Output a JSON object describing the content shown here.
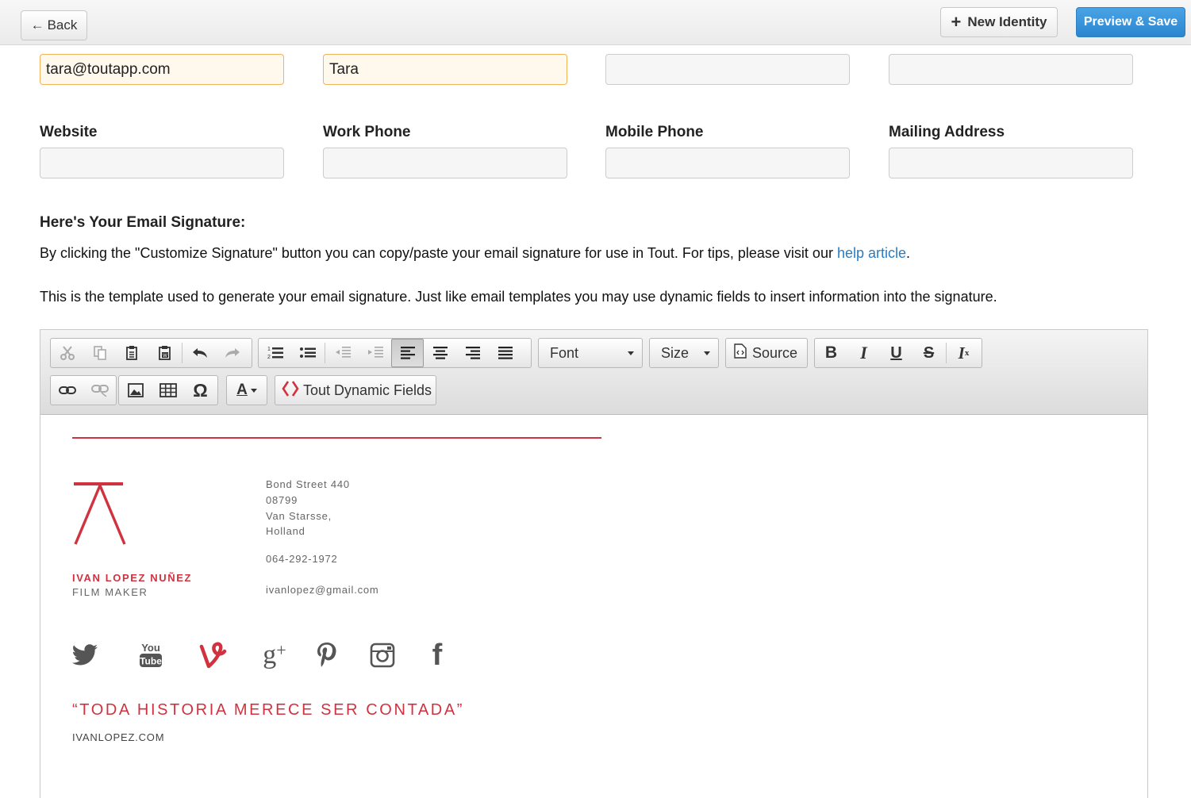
{
  "topbar": {
    "back_label": "Back",
    "new_identity_label": "New Identity",
    "preview_save_label": "Preview & Save"
  },
  "fields": {
    "email_value": "tara@toutapp.com",
    "first_name_value": "Tara",
    "website_label": "Website",
    "work_phone_label": "Work Phone",
    "mobile_phone_label": "Mobile Phone",
    "mailing_address_label": "Mailing Address"
  },
  "signature_section": {
    "heading": "Here's Your Email Signature:",
    "intro_text": "By clicking the \"Customize Signature\" button you can copy/paste your email signature for use in Tout. For tips, please visit our ",
    "help_link": "help article",
    "intro_end": ".",
    "template_text": "This is the template used to generate your email signature. Just like email templates you may use dynamic fields to insert information into the signature."
  },
  "toolbar": {
    "font_label": "Font",
    "size_label": "Size",
    "source_label": "Source",
    "dynamic_fields_label": "Tout Dynamic Fields",
    "icons": [
      "cut-icon",
      "copy-icon",
      "paste-icon",
      "paste-text-icon",
      "paste-word-icon",
      "undo-icon",
      "redo-icon",
      "numbered-list-icon",
      "bulleted-list-icon",
      "outdent-icon",
      "indent-icon",
      "align-left-icon",
      "align-center-icon",
      "align-right-icon",
      "justify-icon",
      "bold-icon",
      "italic-icon",
      "underline-icon",
      "strikethrough-icon",
      "remove-format-icon",
      "link-icon",
      "unlink-icon",
      "image-icon",
      "table-icon",
      "special-char-icon",
      "text-color-icon"
    ]
  },
  "signature": {
    "name": "IVAN LOPEZ NUÑEZ",
    "role": "FILM MAKER",
    "address_line1": "Bond Street 440",
    "address_line2": "08799",
    "address_line3": "Van Starsse,",
    "address_line4": "Holland",
    "phone": "064-292-1972",
    "email": "ivanlopez@gmail.com",
    "quote": "“TODA HISTORIA MERECE SER CONTADA”",
    "website": "IVANLOPEZ.COM",
    "social_icons": [
      "twitter-icon",
      "youtube-icon",
      "vine-icon",
      "google-plus-icon",
      "pinterest-icon",
      "instagram-icon",
      "facebook-icon"
    ],
    "accent_color": "#d0323f"
  },
  "colors": {
    "primary_button": "#2a86cf",
    "link": "#2a7bbf",
    "focus_border": "#f0b35a"
  }
}
